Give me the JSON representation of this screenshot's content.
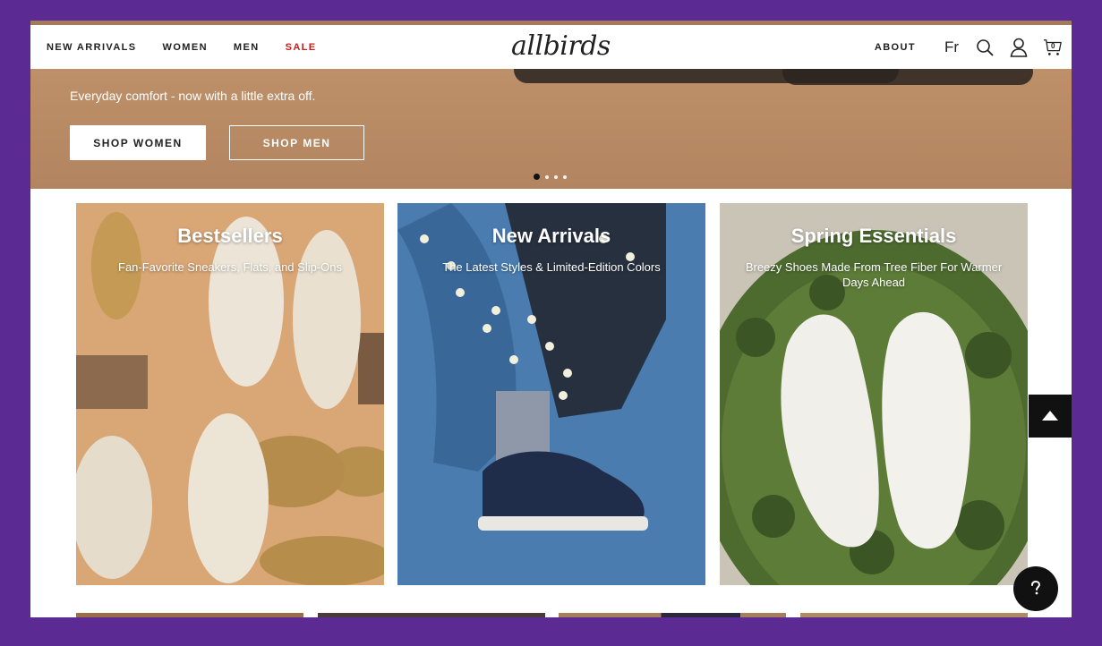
{
  "nav": {
    "links": [
      "NEW ARRIVALS",
      "WOMEN",
      "MEN",
      "SALE"
    ],
    "logo": "allbirds",
    "about": "ABOUT",
    "language": "Fr",
    "cart_count": "0",
    "sale_color": "#c4211f"
  },
  "hero": {
    "subtitle": "Everyday comfort - now with a little extra off.",
    "button_women": "SHOP WOMEN",
    "button_men": "SHOP MEN",
    "slides": 4,
    "active_slide": 1
  },
  "tiles": [
    {
      "title": "Bestsellers",
      "subtitle": "Fan-Favorite Sneakers, Flats, and Slip-Ons"
    },
    {
      "title": "New Arrivals",
      "subtitle": "The Latest Styles & Limited-Edition Colors"
    },
    {
      "title": "Spring Essentials",
      "subtitle": "Breezy Shoes Made From Tree Fiber For Warmer Days Ahead"
    }
  ],
  "icons": {
    "search": "search-icon",
    "account": "account-icon",
    "cart": "cart-icon",
    "back_to_top": "arrow-up-icon",
    "help": "question-icon"
  },
  "colors": {
    "frame": "#5b2a93",
    "text": "#212121",
    "accent_dark": "#111111"
  }
}
